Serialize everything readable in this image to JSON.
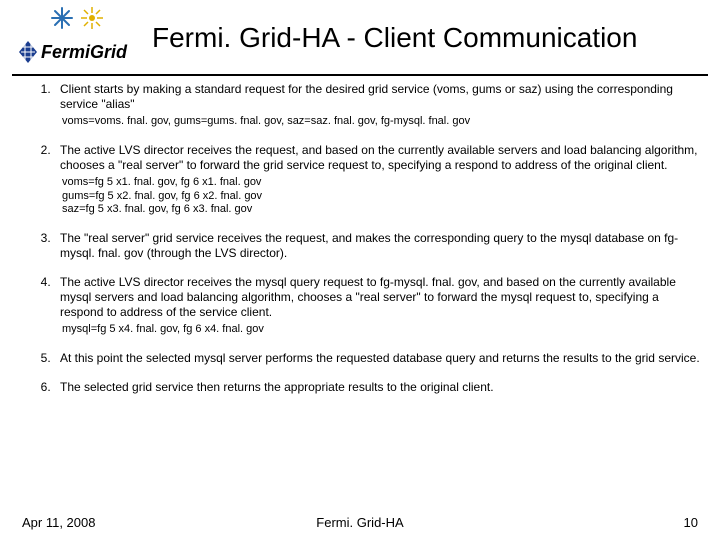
{
  "header": {
    "title": "Fermi. Grid-HA - Client Communication",
    "logo_wordmark": "FermiGrid"
  },
  "steps": [
    {
      "main": "Client starts by making a standard request for the desired grid service (voms, gums or saz) using the corresponding service \"alias\"",
      "subs": [
        "voms=voms. fnal. gov, gums=gums. fnal. gov, saz=saz. fnal. gov, fg-mysql. fnal. gov"
      ]
    },
    {
      "main": "The active LVS director receives the request, and based on the currently available servers and load balancing algorithm, chooses a \"real server\" to forward the grid service request to, specifying a respond to address of the original client.",
      "subs": [
        "voms=fg 5 x1. fnal. gov, fg 6 x1. fnal. gov",
        "gums=fg 5 x2. fnal. gov, fg 6 x2. fnal. gov",
        "saz=fg 5 x3. fnal. gov, fg 6 x3. fnal. gov"
      ]
    },
    {
      "main": "The \"real server\" grid service receives the request, and makes the corresponding query to the mysql database on fg-mysql. fnal. gov (through the LVS director).",
      "subs": []
    },
    {
      "main": "The active LVS director receives the mysql query request to fg-mysql. fnal. gov, and based on the currently available mysql servers and load balancing algorithm, chooses a \"real server\" to forward the mysql request to, specifying a respond to address of the service client.",
      "subs": [
        "mysql=fg 5 x4. fnal. gov, fg 6 x4. fnal. gov"
      ]
    },
    {
      "main": "At this point the selected mysql server performs the requested database query and returns the results to the grid service.",
      "subs": []
    },
    {
      "main": "The selected grid service then returns the appropriate results to the original client.",
      "subs": []
    }
  ],
  "footer": {
    "date": "Apr 11, 2008",
    "center": "Fermi. Grid-HA",
    "page": "10"
  },
  "colors": {
    "snowflake": "#2a6fb3",
    "burst": "#e0b000",
    "diamond": "#1a3d8f"
  }
}
